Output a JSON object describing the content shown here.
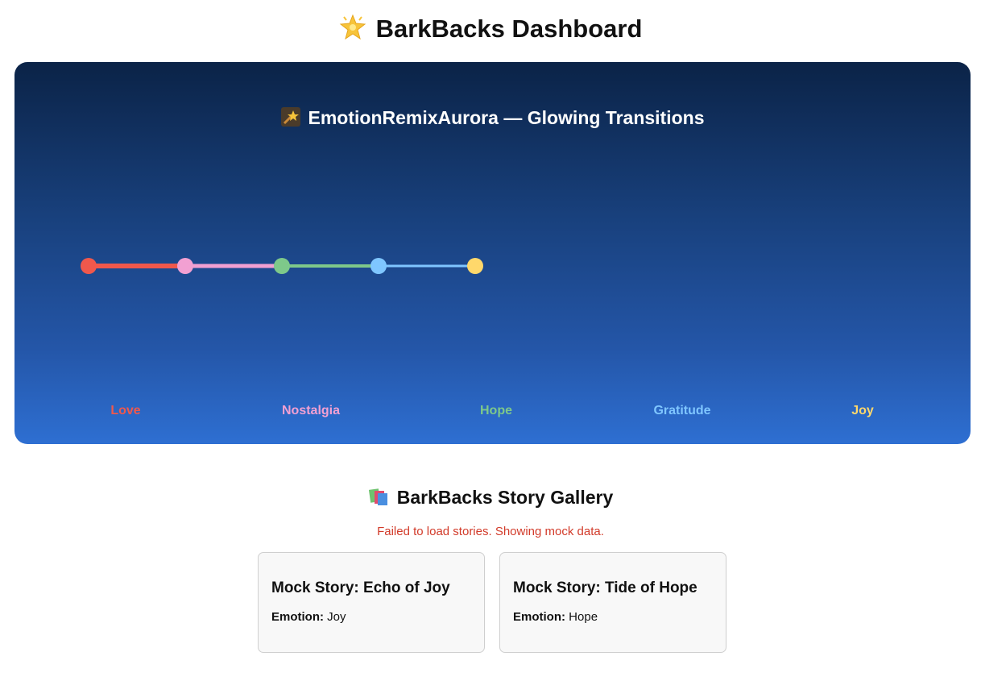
{
  "header": {
    "title": "BarkBacks Dashboard",
    "icon": "glowing-star-icon"
  },
  "aurora": {
    "title": "EmotionRemixAurora — Glowing Transitions",
    "icon": "shooting-star-icon",
    "emotions": [
      {
        "label": "Love",
        "color": "#f0584c"
      },
      {
        "label": "Nostalgia",
        "color": "#f2a0d2"
      },
      {
        "label": "Hope",
        "color": "#7ec98a"
      },
      {
        "label": "Gratitude",
        "color": "#7fc6ff"
      },
      {
        "label": "Joy",
        "color": "#ffd86b"
      }
    ]
  },
  "gallery": {
    "title": "BarkBacks Story Gallery",
    "icon": "books-icon",
    "error": "Failed to load stories. Showing mock data.",
    "emotion_label": "Emotion:",
    "stories": [
      {
        "title": "Mock Story: Echo of Joy",
        "emotion": "Joy"
      },
      {
        "title": "Mock Story: Tide of Hope",
        "emotion": "Hope"
      }
    ]
  }
}
